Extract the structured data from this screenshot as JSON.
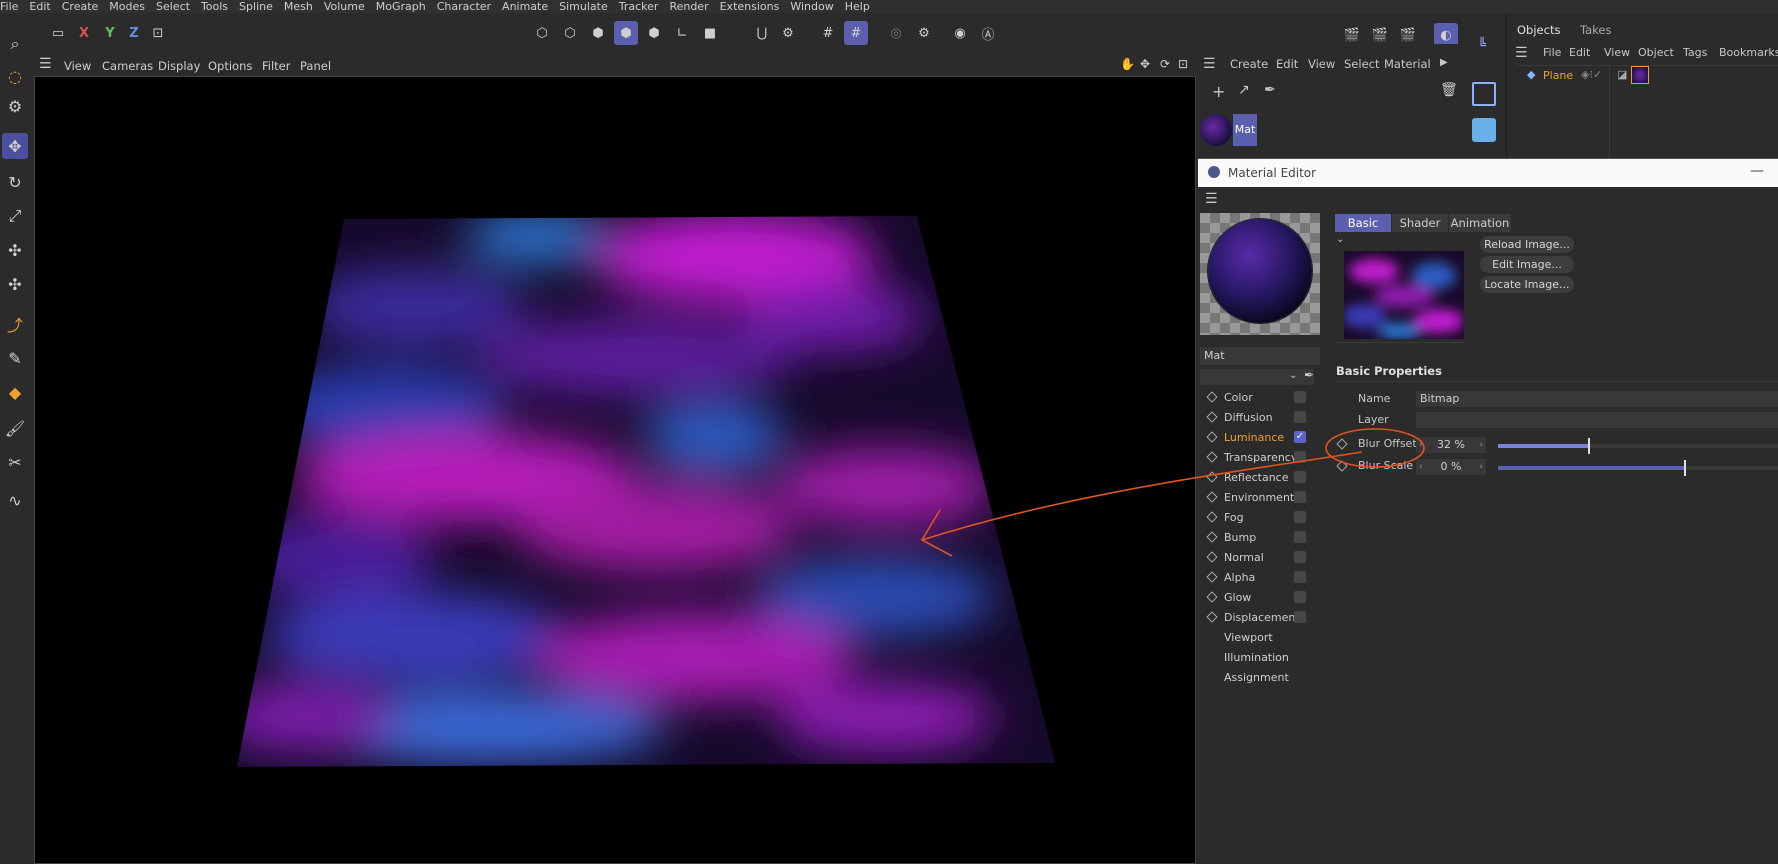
{
  "menu": [
    "File",
    "Edit",
    "Create",
    "Modes",
    "Select",
    "Tools",
    "Spline",
    "Mesh",
    "Volume",
    "MoGraph",
    "Character",
    "Animate",
    "Simulate",
    "Tracker",
    "Render",
    "Extensions",
    "Window",
    "Help"
  ],
  "axes": {
    "x": "X",
    "y": "Y",
    "z": "Z"
  },
  "viewport_menu": [
    "View",
    "Cameras",
    "Display",
    "Options",
    "Filter",
    "Panel"
  ],
  "material_manager": {
    "menu": [
      "Create",
      "Edit",
      "View",
      "Select",
      "Material"
    ],
    "material_name": "Mat"
  },
  "objects_panel": {
    "tabs": [
      "Objects",
      "Takes"
    ],
    "menu": [
      "File",
      "Edit",
      "View",
      "Object",
      "Tags",
      "Bookmarks"
    ],
    "object_name": "Plane"
  },
  "material_editor": {
    "title": "Material Editor",
    "name_field": "Mat",
    "channels": [
      {
        "label": "Color",
        "checked": false
      },
      {
        "label": "Diffusion",
        "checked": false
      },
      {
        "label": "Luminance",
        "checked": true
      },
      {
        "label": "Transparency",
        "checked": false
      },
      {
        "label": "Reflectance",
        "checked": false
      },
      {
        "label": "Environment",
        "checked": false
      },
      {
        "label": "Fog",
        "checked": false
      },
      {
        "label": "Bump",
        "checked": false
      },
      {
        "label": "Normal",
        "checked": false
      },
      {
        "label": "Alpha",
        "checked": false
      },
      {
        "label": "Glow",
        "checked": false
      },
      {
        "label": "Displacement",
        "checked": false
      }
    ],
    "extra_items": [
      "Viewport",
      "Illumination",
      "Assignment"
    ],
    "tabs": [
      "Basic",
      "Shader",
      "Animation"
    ],
    "image_buttons": [
      "Reload Image...",
      "Edit Image...",
      "Locate Image..."
    ],
    "section_title": "Basic Properties",
    "name_label": "Name",
    "name_value": "Bitmap",
    "layer_label": "Layer",
    "blur_offset": {
      "label": "Blur Offset",
      "value": "32 %",
      "fraction": 0.32
    },
    "blur_scale": {
      "label": "Blur Scale",
      "value": "0 %",
      "fraction": 0.0
    }
  },
  "colors": {
    "accent": "#5a5fb0",
    "highlight": "#f0a030",
    "annotation": "#e0551d"
  }
}
